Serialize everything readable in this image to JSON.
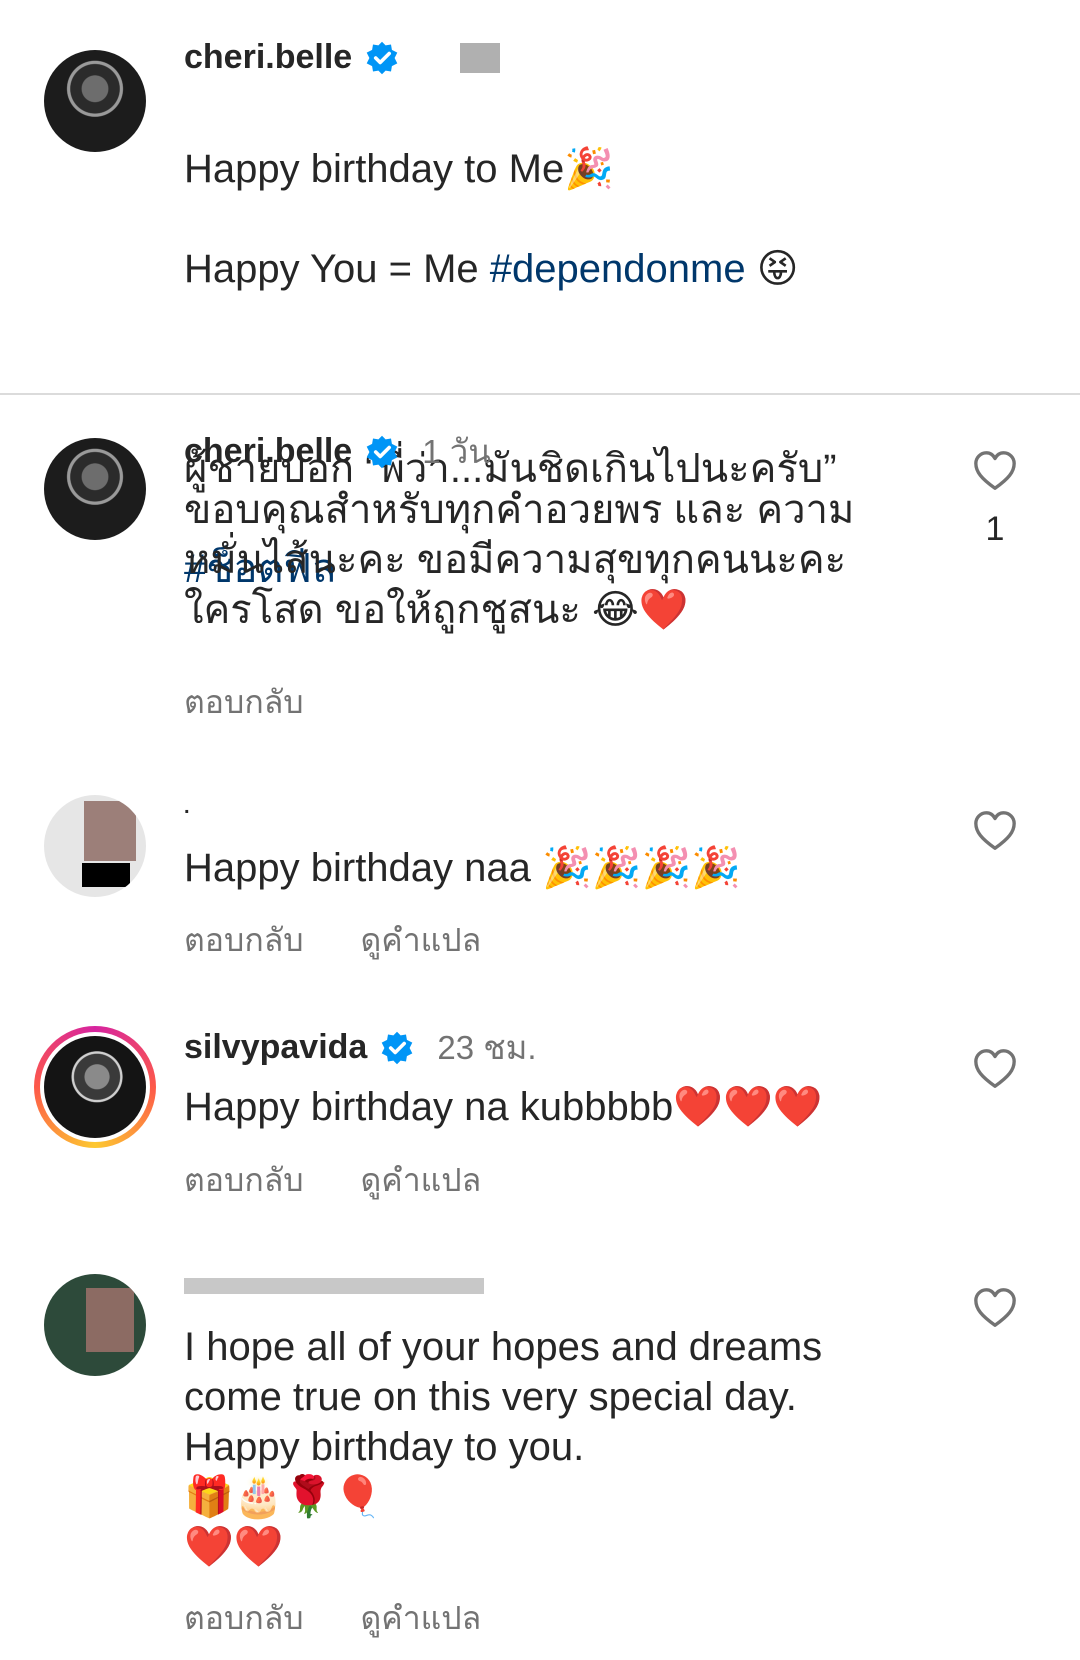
{
  "caption": {
    "username": "cheri.belle",
    "line1": "Happy birthday to Me🎉",
    "line2_prefix": "Happy You = Me ",
    "line2_hashtag": "#dependonme",
    "line2_emoji": "😝",
    "line3": "ผู้ชายบอก “พี่ว่า...มันชิดเกินไปนะครับ”",
    "line4_hashtag": "#ช็อตฟีล"
  },
  "comments": [
    {
      "username": "cheri.belle",
      "time": "1 วัน",
      "text": "ขอบคุณสำหรับทุกคำอวยพร และ ความ\nหมั่นไส้นะคะ ขอมีความสุขทุกคนนะคะ\nใครโสด ขอให้ถูกชูสนะ 😂❤️",
      "likes": "1",
      "reply": "ตอบกลับ"
    },
    {
      "username": ".",
      "text": "Happy birthday naa 🎉🎉🎉🎉",
      "reply": "ตอบกลับ",
      "translate": "ดูคำแปล"
    },
    {
      "username": "silvypavida",
      "time": "23 ชม.",
      "text": "Happy birthday na kubbbbb❤️❤️❤️",
      "reply": "ตอบกลับ",
      "translate": "ดูคำแปล"
    },
    {
      "text": "I hope all of your hopes and dreams\ncome true on this very special day.\nHappy birthday to you.\n🎁🎂🌹🎈\n❤️❤️",
      "reply": "ตอบกลับ",
      "translate": "ดูคำแปล"
    }
  ],
  "icons": {
    "verified": "verified-badge-icon",
    "like": "heart-outline-icon"
  },
  "colors": {
    "text": "#262626",
    "secondary": "#737373",
    "hashtag": "#00376b",
    "verified": "#0095f6"
  }
}
